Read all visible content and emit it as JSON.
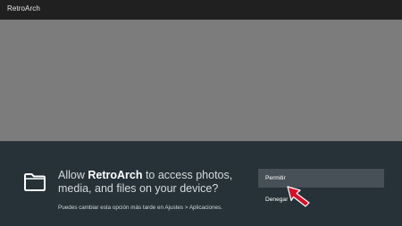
{
  "app": {
    "title": "RetroArch"
  },
  "dialog": {
    "message_prefix": "Allow ",
    "message_app": "RetroArch",
    "message_suffix": " to access photos, media, and files on your device?",
    "hint": "Puedes cambiar esta opción más tarde en Ajustes > Aplicaciones.",
    "icon": "folder-icon",
    "buttons": {
      "allow": "Permitir",
      "deny": "Denegar"
    }
  },
  "pointer": {
    "icon": "arrow-pointer-icon",
    "color": "#d4102a"
  },
  "colors": {
    "appbar": "#202020",
    "content": "#7c7c7c",
    "dialog": "#263238",
    "focused_button": "#475057"
  }
}
